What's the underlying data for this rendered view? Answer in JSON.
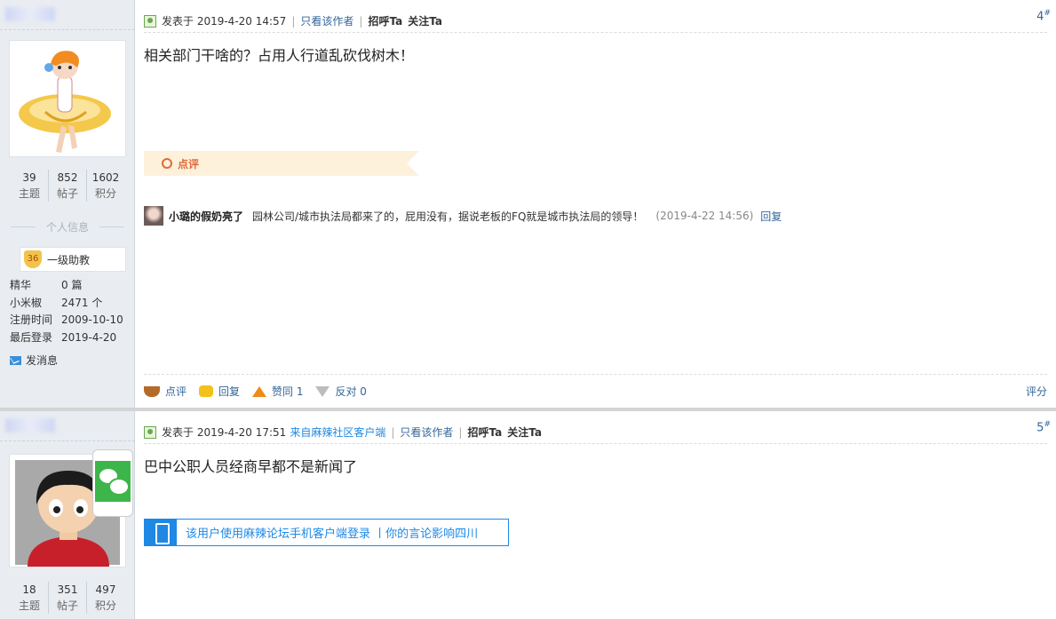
{
  "posts": [
    {
      "user": {
        "stats": [
          {
            "value": "39",
            "label": "主题"
          },
          {
            "value": "852",
            "label": "帖子"
          },
          {
            "value": "1602",
            "label": "积分"
          }
        ],
        "info_title": "个人信息",
        "rank_level": "36",
        "rank_name": "一级助教",
        "info": [
          {
            "key": "精华",
            "value": "0 篇"
          },
          {
            "key": "小米椒",
            "value": "2471 个"
          },
          {
            "key": "注册时间",
            "value": "2009-10-10"
          },
          {
            "key": "最后登录",
            "value": "2019-4-20"
          }
        ],
        "send_msg": "发消息"
      },
      "meta": {
        "posted": "发表于 2019-4-20 14:57",
        "only_author": "只看该作者",
        "greet": "招呼Ta",
        "follow": "关注Ta",
        "floor_num": "4",
        "floor_suffix": "#"
      },
      "content": "相关部门干啥的？占用人行道乱砍伐树木！",
      "dianping_label": "点评",
      "comment": {
        "user": "小璐的假奶亮了",
        "text": "园林公司/城市执法局都来了的，屁用没有，据说老板的FQ就是城市执法局的领导！",
        "time": "(2019-4-22 14:56)",
        "reply": "回复"
      },
      "actions": {
        "dianping": "点评",
        "reply": "回复",
        "like": "赞同 1",
        "dislike": "反对 0",
        "rate": "评分"
      }
    },
    {
      "user": {
        "stats": [
          {
            "value": "18",
            "label": "主题"
          },
          {
            "value": "351",
            "label": "帖子"
          },
          {
            "value": "497",
            "label": "积分"
          }
        ]
      },
      "meta": {
        "posted": "发表于 2019-4-20 17:51",
        "source": "来自麻辣社区客户端",
        "only_author": "只看该作者",
        "greet": "招呼Ta",
        "follow": "关注Ta",
        "floor_num": "5",
        "floor_suffix": "#"
      },
      "content": "巴中公职人员经商早都不是新闻了",
      "mobile_banner": "该用户使用麻辣论坛手机客户端登录 丨你的言论影响四川"
    }
  ]
}
